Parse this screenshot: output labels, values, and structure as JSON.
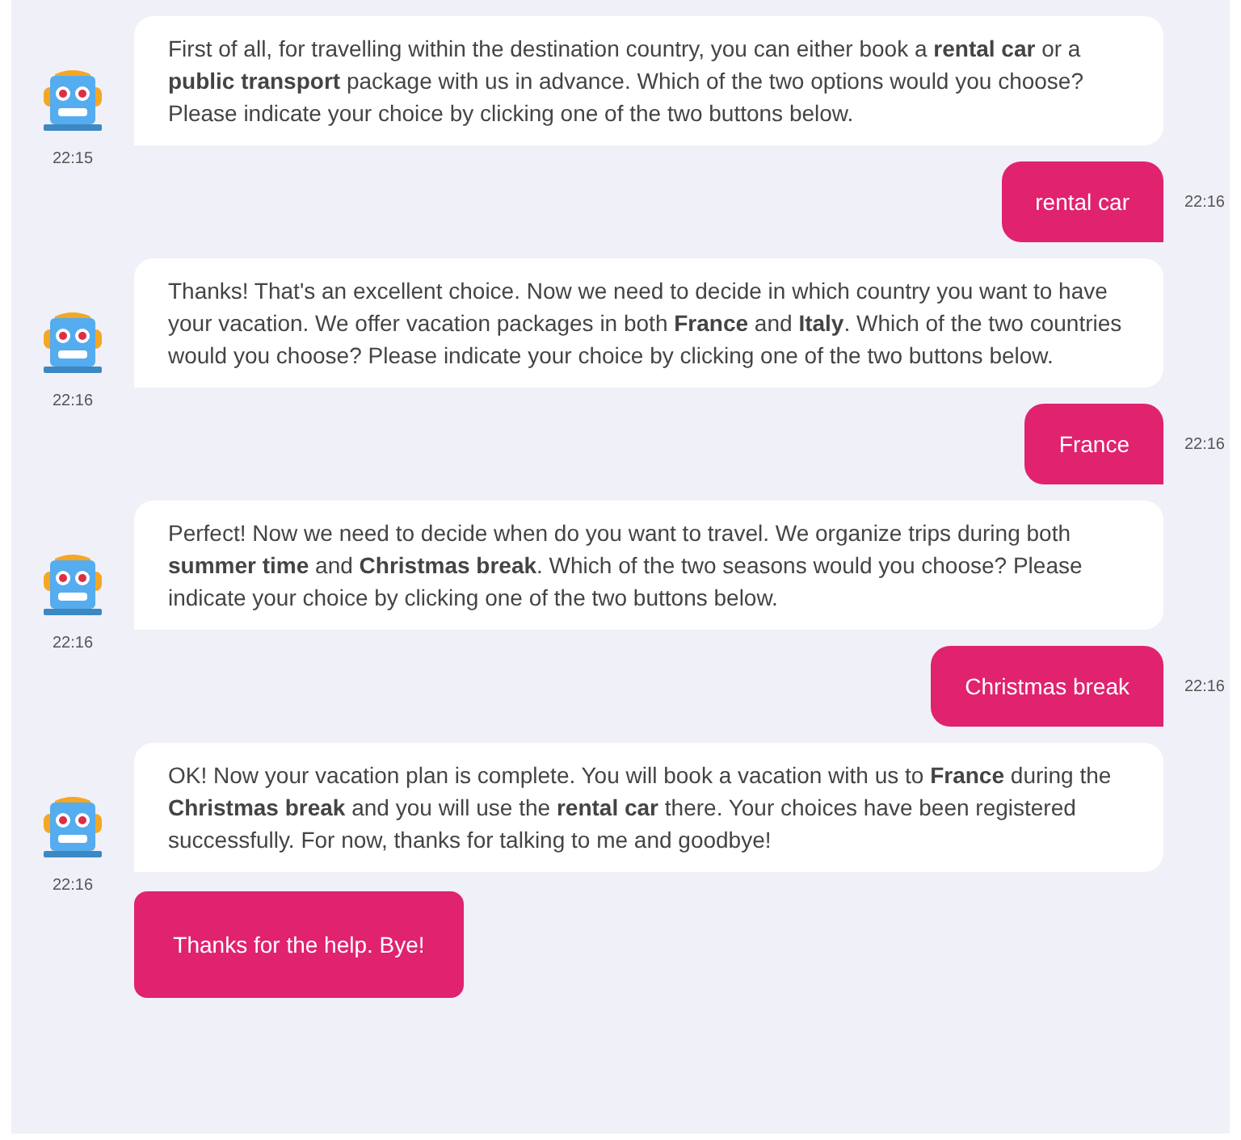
{
  "messages": [
    {
      "kind": "bot",
      "text": "First of all, for travelling within the destination country, you can either book a **rental car** or a **public transport** package with us in advance. Which of the two options would you choose? Please indicate your choice by clicking one of the two buttons below.",
      "time": "22:15"
    },
    {
      "kind": "user",
      "text": "rental car",
      "time": "22:16"
    },
    {
      "kind": "bot",
      "text": "Thanks! That's an excellent choice. Now we need to decide in which country you want to have your vacation. We offer vacation packages in both **France** and **Italy**. Which of the two countries would you choose? Please indicate your choice by clicking one of the two buttons below.",
      "time": "22:16"
    },
    {
      "kind": "user",
      "text": "France",
      "time": "22:16"
    },
    {
      "kind": "bot",
      "text": "Perfect! Now we need to decide when do you want to travel. We organize trips during both **summer time** and **Christmas break**. Which of the two seasons would you choose? Please indicate your choice by clicking one of the two buttons below.",
      "time": "22:16"
    },
    {
      "kind": "user",
      "text": "Christmas break",
      "time": "22:16"
    },
    {
      "kind": "bot",
      "text": "OK! Now your vacation plan is complete. You will book a vacation with us to **France** during the **Christmas break** and you will use the **rental car** there. Your choices have been registered successfully. For now, thanks for talking to me and goodbye!",
      "time": "22:16"
    }
  ],
  "reply_button": "Thanks for the help. Bye!"
}
